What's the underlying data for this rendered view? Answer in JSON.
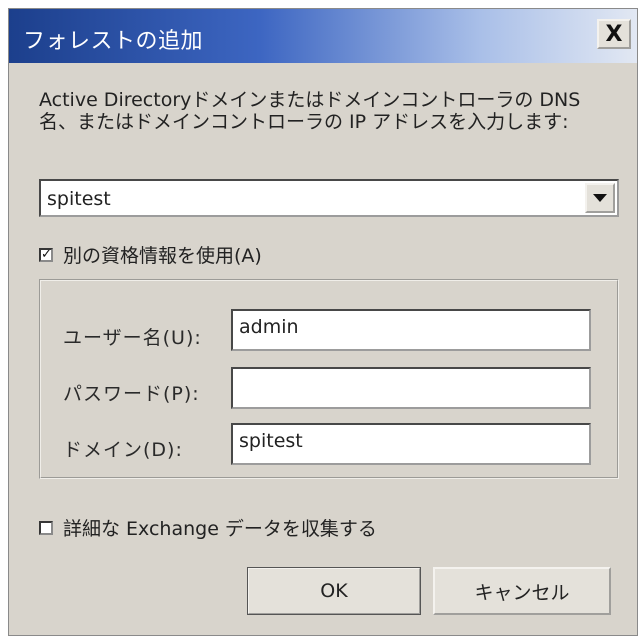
{
  "window": {
    "title": "フォレストの追加",
    "close_label": "X"
  },
  "instructions": "Active Directoryドメインまたはドメインコントローラの DNS 名、またはドメインコントローラの IP アドレスを入力します:",
  "server_combo": {
    "value": "spitest"
  },
  "alt_credentials": {
    "label": "別の資格情報を使用(A)",
    "checked": true,
    "check_glyph": "✓"
  },
  "fields": {
    "username": {
      "label": "ユーザー名(U):",
      "value": "admin"
    },
    "password": {
      "label": "パスワード(P):",
      "value": ""
    },
    "domain": {
      "label": "ドメイン(D):",
      "value": "spitest"
    }
  },
  "exchange": {
    "label": "詳細な Exchange データを収集する",
    "checked": false
  },
  "buttons": {
    "ok": "OK",
    "cancel": "キャンセル"
  }
}
